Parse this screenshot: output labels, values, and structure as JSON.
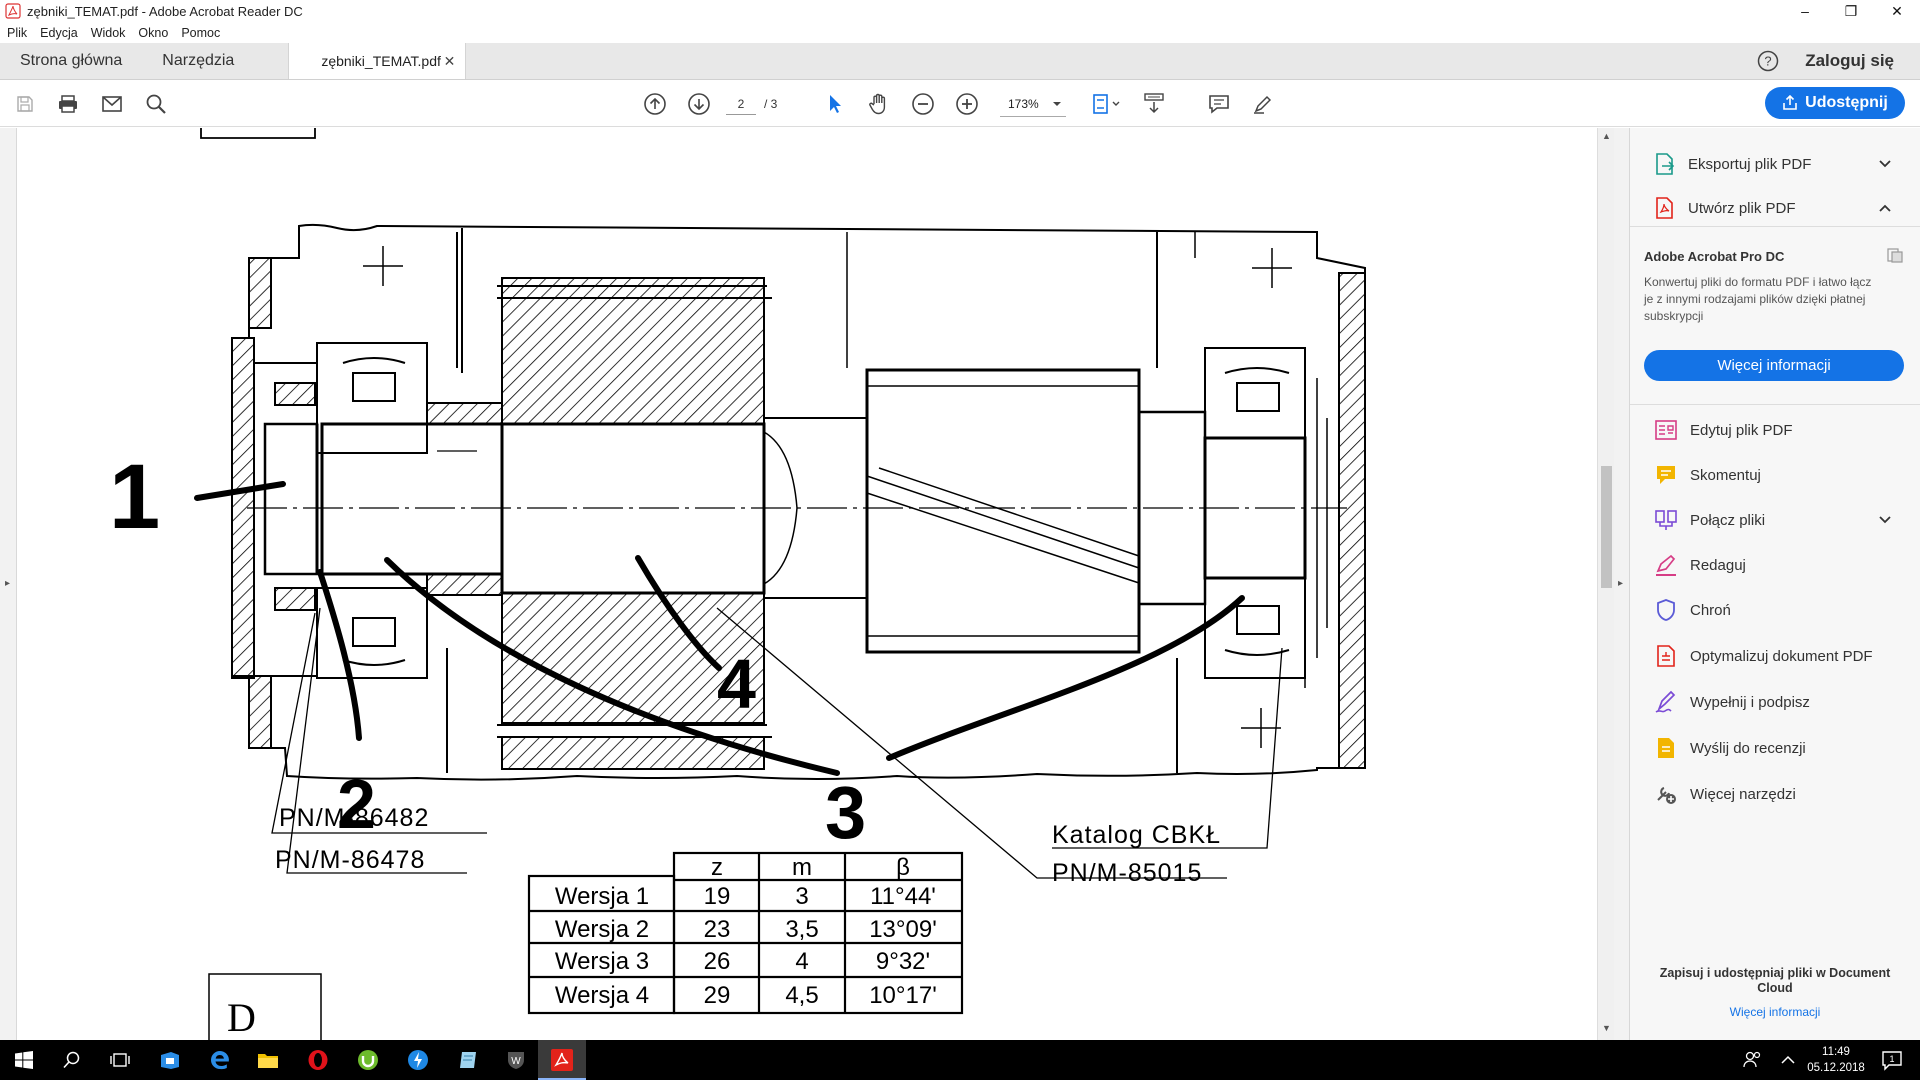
{
  "window": {
    "title": "zębniki_TEMAT.pdf - Adobe Acrobat Reader DC",
    "controls": {
      "minimize": "–",
      "restore": "❐",
      "close": "✕"
    }
  },
  "menu": [
    "Plik",
    "Edycja",
    "Widok",
    "Okno",
    "Pomoc"
  ],
  "tabs": {
    "home": "Strona główna",
    "tools": "Narzędzia",
    "document": "zębniki_TEMAT.pdf",
    "close_glyph": "✕"
  },
  "signin": "Zaloguj się",
  "toolbar": {
    "page_current": "2",
    "page_total": "/ 3",
    "zoom": "173%",
    "share_label": "Udostępnij"
  },
  "drawing": {
    "labels": {
      "std1": "PN/M-86482",
      "std2": "PN/M-86478",
      "catalog": "Katalog CBKŁ",
      "std3": "PN/M-85015",
      "box": "D"
    },
    "handwritten": {
      "n1": "1",
      "n2": "2",
      "n3": "3",
      "n4": "4"
    },
    "table": {
      "headers": [
        "",
        "z",
        "m",
        "β"
      ],
      "rows": [
        [
          "Wersja 1",
          "19",
          "3",
          "11°44'"
        ],
        [
          "Wersja 2",
          "23",
          "3,5",
          "13°09'"
        ],
        [
          "Wersja 3",
          "26",
          "4",
          "9°32'"
        ],
        [
          "Wersja 4",
          "29",
          "4,5",
          "10°17'"
        ]
      ]
    }
  },
  "right_panel": {
    "export": "Eksportuj plik PDF",
    "create": "Utwórz plik PDF",
    "promo_title": "Adobe Acrobat Pro DC",
    "promo_text": "Konwertuj pliki do formatu PDF i łatwo łącz je z innymi rodzajami plików dzięki płatnej subskrypcji",
    "promo_button": "Więcej informacji",
    "tools": [
      "Edytuj plik PDF",
      "Skomentuj",
      "Połącz pliki",
      "Redaguj",
      "Chroń",
      "Optymalizuj dokument PDF",
      "Wypełnij i podpisz",
      "Wyślij do recenzji",
      "Więcej narzędzi"
    ],
    "footer": "Zapisuj i udostępniaj pliki w Document Cloud",
    "footer_link": "Więcej informacji"
  },
  "taskbar": {
    "time": "11:49",
    "date": "05.12.2018",
    "notification_count": "1"
  },
  "colors": {
    "accent": "#1473e6",
    "acrobat_red": "#e2231a",
    "taskbar": "#000000"
  }
}
